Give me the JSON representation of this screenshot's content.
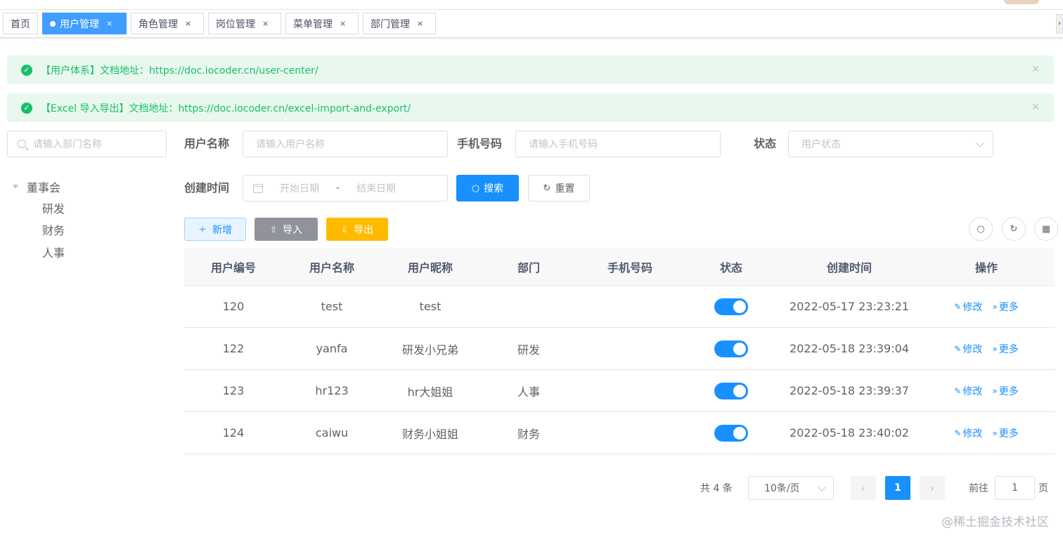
{
  "tags": [
    {
      "label": "首页",
      "active": false,
      "closable": false
    },
    {
      "label": "用户管理",
      "active": true,
      "closable": true
    },
    {
      "label": "角色管理",
      "active": false,
      "closable": true
    },
    {
      "label": "岗位管理",
      "active": false,
      "closable": true
    },
    {
      "label": "菜单管理",
      "active": false,
      "closable": true
    },
    {
      "label": "部门管理",
      "active": false,
      "closable": true
    }
  ],
  "tag_close_glyph": "×",
  "alerts": [
    {
      "text": "【用户体系】文档地址：https://doc.iocoder.cn/user-center/"
    },
    {
      "text": "【Excel 导入导出】文档地址：https://doc.iocoder.cn/excel-import-and-export/"
    }
  ],
  "dept": {
    "search_placeholder": "请输入部门名称",
    "root": "董事会",
    "children": [
      "研发",
      "财务",
      "人事"
    ]
  },
  "form": {
    "username_label": "用户名称",
    "username_placeholder": "请输入用户名称",
    "mobile_label": "手机号码",
    "mobile_placeholder": "请输入手机号码",
    "status_label": "状态",
    "status_placeholder": "用户状态",
    "created_label": "创建时间",
    "start_placeholder": "开始日期",
    "range_separator": "-",
    "end_placeholder": "结束日期",
    "search_btn": "搜索",
    "reset_btn": "重置"
  },
  "toolbar": {
    "add": "新增",
    "import": "导入",
    "export": "导出"
  },
  "table": {
    "headers": [
      "用户编号",
      "用户名称",
      "用户昵称",
      "部门",
      "手机号码",
      "状态",
      "创建时间",
      "操作"
    ],
    "rows": [
      {
        "id": "120",
        "username": "test",
        "nickname": "test",
        "dept": "",
        "mobile": "",
        "enabled": true,
        "created": "2022-05-17 23:23:21"
      },
      {
        "id": "122",
        "username": "yanfa",
        "nickname": "研发小兄弟",
        "dept": "研发",
        "mobile": "",
        "enabled": true,
        "created": "2022-05-18 23:39:04"
      },
      {
        "id": "123",
        "username": "hr123",
        "nickname": "hr大姐姐",
        "dept": "人事",
        "mobile": "",
        "enabled": true,
        "created": "2022-05-18 23:39:37"
      },
      {
        "id": "124",
        "username": "caiwu",
        "nickname": "财务小姐姐",
        "dept": "财务",
        "mobile": "",
        "enabled": true,
        "created": "2022-05-18 23:40:02"
      }
    ],
    "edit_label": "修改",
    "more_label": "更多"
  },
  "pagination": {
    "total_text": "共 4 条",
    "page_size": "10条/页",
    "current_page": "1",
    "goto_label": "前往",
    "goto_value": "1",
    "goto_unit": "页"
  },
  "watermark": "@稀土掘金技术社区",
  "colors": {
    "primary": "#1890ff",
    "success": "#19be6b",
    "warning": "#ffba00",
    "info": "#909399"
  }
}
